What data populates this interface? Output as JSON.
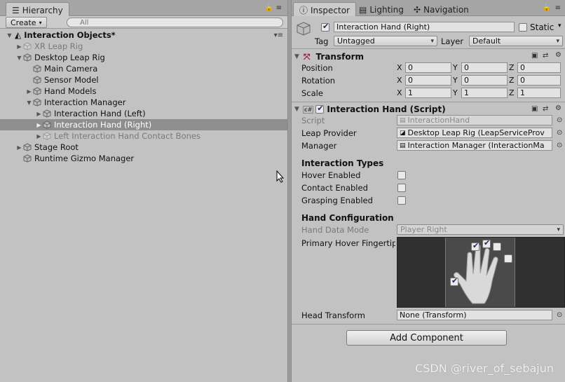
{
  "hierarchy": {
    "tab_label": "Hierarchy",
    "create_label": "Create",
    "search_placeholder": "All",
    "scene_name": "Interaction Objects*",
    "items": [
      {
        "label": "XR Leap Rig",
        "depth": 1,
        "arrow": "right",
        "dim": true
      },
      {
        "label": "Desktop Leap Rig",
        "depth": 1,
        "arrow": "down",
        "dim": false
      },
      {
        "label": "Main Camera",
        "depth": 2,
        "arrow": "",
        "dim": false
      },
      {
        "label": "Sensor Model",
        "depth": 2,
        "arrow": "",
        "dim": false
      },
      {
        "label": "Hand Models",
        "depth": 2,
        "arrow": "right",
        "dim": false
      },
      {
        "label": "Interaction Manager",
        "depth": 2,
        "arrow": "down",
        "dim": false
      },
      {
        "label": "Interaction Hand (Left)",
        "depth": 3,
        "arrow": "right",
        "dim": false
      },
      {
        "label": "Interaction Hand (Right)",
        "depth": 3,
        "arrow": "right",
        "dim": false,
        "selected": true
      },
      {
        "label": "Left Interaction Hand Contact Bones",
        "depth": 3,
        "arrow": "right",
        "dim": true
      },
      {
        "label": "Stage Root",
        "depth": 1,
        "arrow": "right",
        "dim": false
      },
      {
        "label": "Runtime Gizmo Manager",
        "depth": 1,
        "arrow": "",
        "dim": false
      }
    ]
  },
  "inspector": {
    "tabs": {
      "inspector": "Inspector",
      "lighting": "Lighting",
      "navigation": "Navigation"
    },
    "object_name": "Interaction Hand (Right)",
    "static_label": "Static",
    "tag_label": "Tag",
    "tag_value": "Untagged",
    "layer_label": "Layer",
    "layer_value": "Default",
    "transform": {
      "title": "Transform",
      "position_label": "Position",
      "rotation_label": "Rotation",
      "scale_label": "Scale",
      "x": "X",
      "y": "Y",
      "z": "Z",
      "position": [
        "0",
        "0",
        "0"
      ],
      "rotation": [
        "0",
        "0",
        "0"
      ],
      "scale": [
        "1",
        "1",
        "1"
      ]
    },
    "script_component": {
      "title": "Interaction Hand (Script)",
      "script_label": "Script",
      "script_value": "InteractionHand",
      "leap_provider_label": "Leap Provider",
      "leap_provider_value": "Desktop Leap Rig (LeapServiceProv",
      "manager_label": "Manager",
      "manager_value": "Interaction Manager (InteractionMa",
      "interaction_types_label": "Interaction Types",
      "hover_label": "Hover Enabled",
      "contact_label": "Contact Enabled",
      "grasping_label": "Grasping Enabled",
      "hover_enabled": false,
      "contact_enabled": false,
      "grasping_enabled": false,
      "hand_config_label": "Hand Configuration",
      "hand_data_mode_label": "Hand Data Mode",
      "hand_data_mode_value": "Player Right",
      "primary_hover_label": "Primary Hover Fingertip",
      "fingertips_checked": {
        "thumb": true,
        "index": true,
        "middle": true,
        "ring": false,
        "pinky": false
      },
      "head_transform_label": "Head Transform",
      "head_transform_value": "None (Transform)"
    },
    "add_component_label": "Add Component"
  },
  "watermark": "CSDN @river_of_sebajun",
  "colors": {
    "panel": "#c2c2c2",
    "selection": "#8e8e8e",
    "field": "#e2e2e2"
  }
}
